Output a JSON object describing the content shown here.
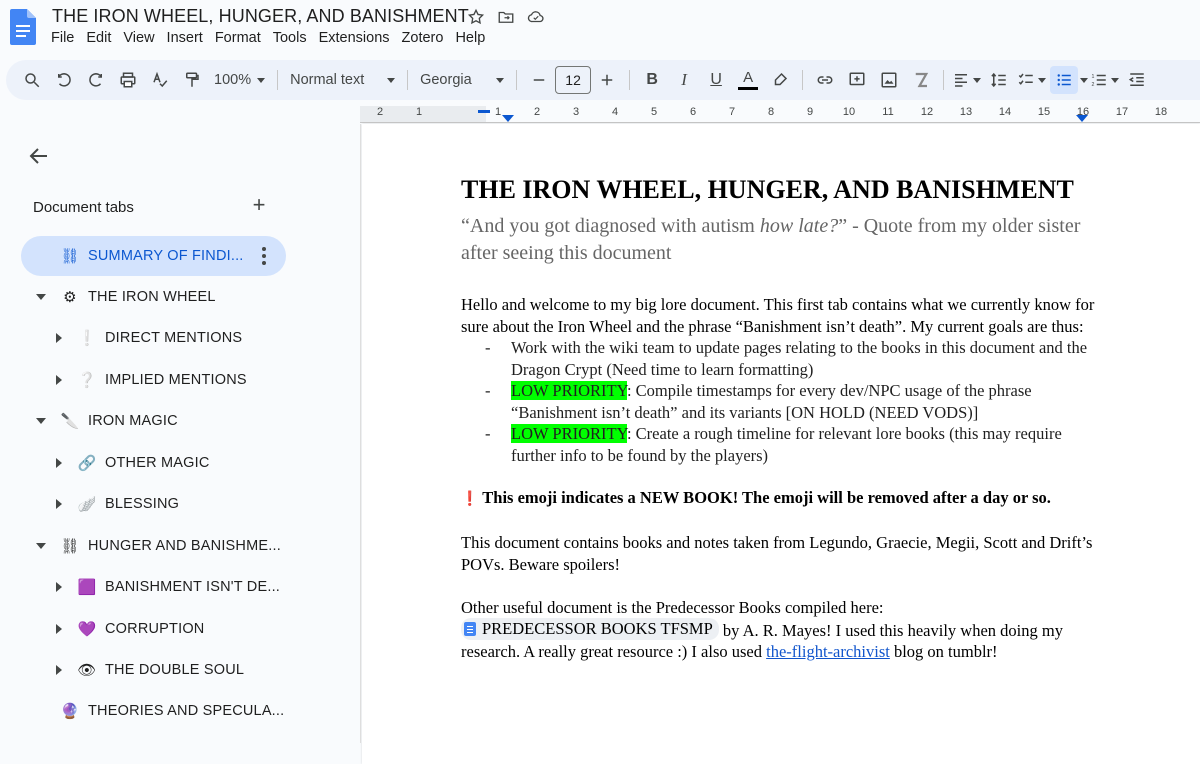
{
  "app": {
    "title": "THE IRON WHEEL, HUNGER, AND BANISHMENT",
    "menu": [
      "File",
      "Edit",
      "View",
      "Insert",
      "Format",
      "Tools",
      "Extensions",
      "Zotero",
      "Help"
    ]
  },
  "toolbar": {
    "zoom": "100%",
    "style": "Normal text",
    "font": "Georgia",
    "font_size": "12",
    "icons": [
      "search-icon",
      "undo-icon",
      "redo-icon",
      "print-icon",
      "spellcheck-icon",
      "paint-format-icon",
      "bold-icon",
      "italic-icon",
      "underline-icon",
      "text-color-icon",
      "highlight-icon",
      "link-icon",
      "comment-icon",
      "image-icon",
      "clear-format-icon",
      "align-icon",
      "line-spacing-icon",
      "checklist-icon",
      "bulleted-list-icon",
      "numbered-list-icon",
      "decrease-indent-icon"
    ]
  },
  "ruler": {
    "labels": [
      "2",
      "1",
      "1",
      "2",
      "3",
      "4",
      "5",
      "6",
      "7",
      "8",
      "9",
      "10",
      "11",
      "12",
      "13",
      "14",
      "15",
      "16",
      "17",
      "18"
    ]
  },
  "sidebar": {
    "header": "Document tabs",
    "tabs": [
      {
        "label": "SUMMARY OF FINDI...",
        "emoji": "⛓",
        "selected": true,
        "arrow": "none"
      },
      {
        "label": "THE IRON WHEEL",
        "emoji": "⚙",
        "arrow": "down"
      },
      {
        "label": "DIRECT MENTIONS",
        "emoji": "❕",
        "arrow": "right"
      },
      {
        "label": "IMPLIED MENTIONS",
        "emoji": "❔",
        "arrow": "right"
      },
      {
        "label": "IRON MAGIC",
        "emoji": "🔪",
        "arrow": "down"
      },
      {
        "label": "OTHER MAGIC",
        "emoji": "🔗",
        "arrow": "right"
      },
      {
        "label": "BLESSING",
        "emoji": "🪽",
        "arrow": "right"
      },
      {
        "label": "HUNGER AND BANISHME...",
        "emoji": "⛓",
        "arrow": "down"
      },
      {
        "label": "BANISHMENT ISN'T DE...",
        "emoji": "🟪",
        "arrow": "right"
      },
      {
        "label": "CORRUPTION",
        "emoji": "💜",
        "arrow": "right"
      },
      {
        "label": "THE DOUBLE SOUL",
        "emoji": "👁",
        "arrow": "right"
      },
      {
        "label": "THEORIES AND SPECULA...",
        "emoji": "🔮",
        "arrow": "none"
      }
    ]
  },
  "doc": {
    "title": "THE IRON WHEEL, HUNGER, AND BANISHMENT",
    "subtitle_pre": "“And you got diagnosed with autism ",
    "subtitle_em": "how late?",
    "subtitle_post": "” - Quote from my older sister after seeing this document",
    "intro": "Hello and welcome to my big lore document. This first tab contains what we currently know for sure about the Iron Wheel and the phrase “Banishment isn’t death”. My current goals are thus:",
    "bullet1": "Work with the wiki team to update pages relating to the books in this document and the Dragon Crypt (Need time to learn formatting)",
    "bullet2_hl": "LOW PRIORITY",
    "bullet2": ": Compile timestamps for every dev/NPC usage of the phrase “Banishment isn’t death” and its variants [ON HOLD (NEED VODS)]",
    "bullet3_hl": "LOW PRIORITY",
    "bullet3": ": Create a rough timeline for relevant lore books (this may require further info to be found by the players)",
    "notice_emoji": "❗",
    "notice": "This emoji indicates a NEW BOOK! The emoji will be removed after a day or so.",
    "povs": "This document contains books and notes taken from Legundo, Graecie, Megii, Scott and Drift’s POVs. Beware spoilers!",
    "other_pre": "Other useful document is the Predecessor Books compiled here:",
    "chip": "PREDECESSOR BOOKS TFSMP",
    "other_mid": " by A. R. Mayes! I used this heavily when doing my research. A really great resource :) I also used ",
    "link": "the-flight-archivist",
    "other_post": " blog on tumblr!"
  },
  "colors": {
    "accent": "#0b57d0",
    "selected_tab_bg": "#d3e3fd",
    "toolbar_bg": "#edf2fa",
    "highlight": "#00ff00",
    "link": "#1155cc"
  }
}
